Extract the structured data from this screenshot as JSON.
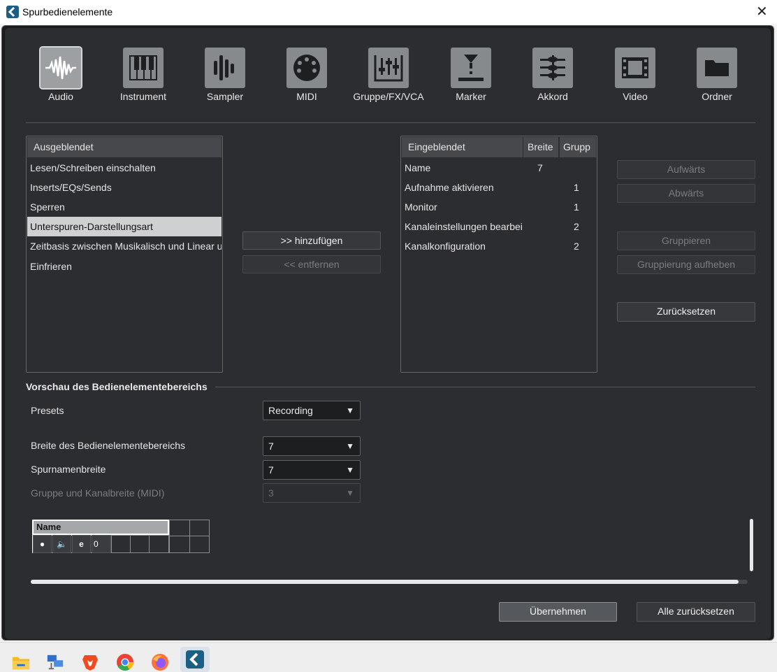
{
  "window": {
    "title": "Spurbedienelemente"
  },
  "track_types": [
    {
      "label": "Audio",
      "icon": "waveform-icon",
      "active": true
    },
    {
      "label": "Instrument",
      "icon": "piano-icon"
    },
    {
      "label": "Sampler",
      "icon": "sampler-icon"
    },
    {
      "label": "MIDI",
      "icon": "midi-connector-icon"
    },
    {
      "label": "Gruppe/FX/VCA",
      "icon": "mixer-icon"
    },
    {
      "label": "Marker",
      "icon": "marker-icon"
    },
    {
      "label": "Akkord",
      "icon": "chord-icon"
    },
    {
      "label": "Video",
      "icon": "film-icon"
    },
    {
      "label": "Ordner",
      "icon": "folder-icon"
    }
  ],
  "hidden_list": {
    "header": "Ausgeblendet",
    "items": [
      "Lesen/Schreiben einschalten",
      "Inserts/EQs/Sends",
      "Sperren",
      "Unterspuren-Darstellungsart",
      "Zeitbasis zwischen Musikalisch und Linear ur",
      "Einfrieren"
    ],
    "selected_index": 3
  },
  "transfer_buttons": {
    "add": ">> hinzufügen",
    "remove": "<< entfernen"
  },
  "visible_list": {
    "headers": {
      "name": "Eingeblendet",
      "width": "Breite",
      "group": "Grupp"
    },
    "rows": [
      {
        "name": "Name",
        "width": "7",
        "group": ""
      },
      {
        "name": "Aufnahme aktivieren",
        "width": "",
        "group": "1"
      },
      {
        "name": "Monitor",
        "width": "",
        "group": "1"
      },
      {
        "name": "Kanaleinstellungen bearbei",
        "width": "",
        "group": "2"
      },
      {
        "name": "Kanalkonfiguration",
        "width": "",
        "group": "2"
      }
    ]
  },
  "side_buttons": {
    "up": "Aufwärts",
    "down": "Abwärts",
    "group": "Gruppieren",
    "ungroup": "Gruppierung aufheben",
    "reset": "Zurücksetzen"
  },
  "preview": {
    "section_title": "Vorschau des Bedienelementebereichs",
    "presets_label": "Presets",
    "presets_value": "Recording",
    "width_label": "Breite des Bedienelementebereichs",
    "width_value": "7",
    "trackname_label": "Spurnamenbreite",
    "trackname_value": "7",
    "midi_label": "Gruppe und Kanalbreite (MIDI)",
    "midi_value": "3",
    "track_name": "Name",
    "monitor_value": "0"
  },
  "footer": {
    "apply": "Übernehmen",
    "reset_all": "Alle zurücksetzen"
  },
  "taskbar": {
    "apps": [
      "file-explorer-icon",
      "network-icon",
      "brave-browser-icon",
      "chrome-browser-icon",
      "firefox-browser-icon",
      "cubase-icon"
    ]
  }
}
